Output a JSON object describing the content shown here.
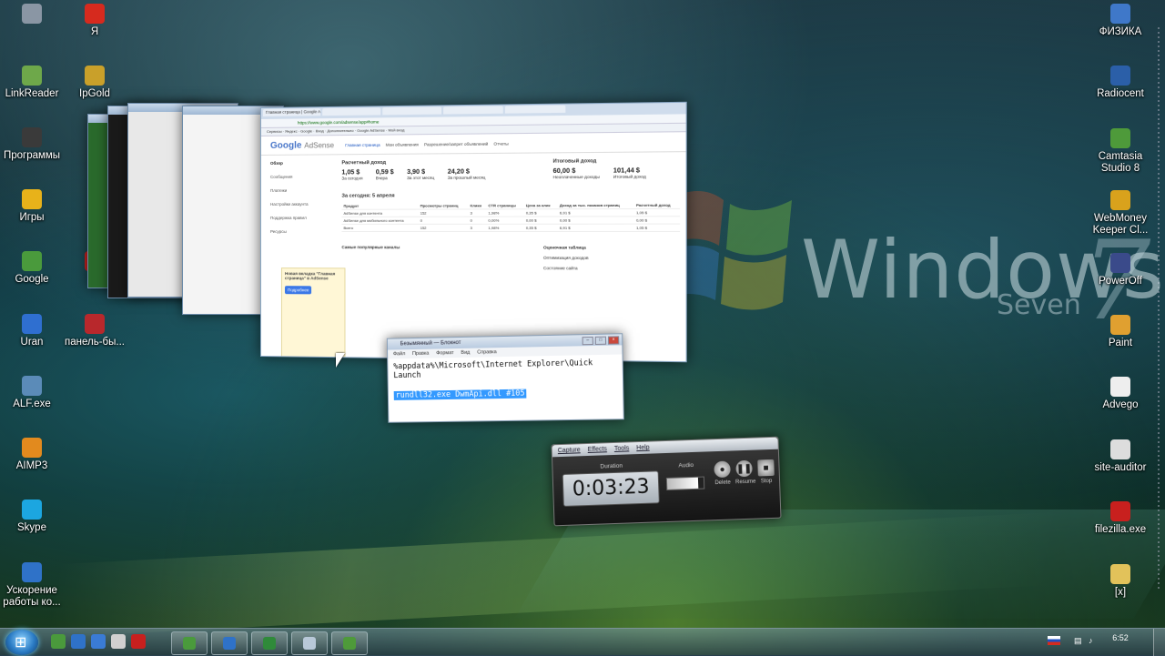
{
  "desktop": {
    "left_icons": [
      {
        "label": "",
        "icon": "small-app-icon",
        "color": "#8a96a4"
      },
      {
        "label": "Я",
        "icon": "yandex-icon",
        "color": "#d62a1e"
      },
      {
        "label": "LinkReader",
        "icon": "linkreader-icon",
        "color": "#6ea84a"
      },
      {
        "label": "IpGold",
        "icon": "ipgold-icon",
        "color": "#c9a02a"
      },
      {
        "label": "Программы",
        "icon": "programs-folder-icon",
        "color": "#3a3a3a"
      },
      {
        "label": "Игры",
        "icon": "games-star-icon",
        "color": "#e8b21a"
      },
      {
        "label": "Google",
        "icon": "chrome-icon",
        "color": "#4a9a3c"
      },
      {
        "label": "",
        "icon": "opera-icon",
        "color": "#c8201e"
      },
      {
        "label": "Uran",
        "icon": "uran-browser-icon",
        "color": "#2f6fd0"
      },
      {
        "label": "панель-бы...",
        "icon": "panel-icon",
        "color": "#b8282c"
      },
      {
        "label": "ALF.exe",
        "icon": "shield-icon",
        "color": "#5b8bb8"
      },
      {
        "label": "AIMP3",
        "icon": "aimp-icon",
        "color": "#e28a1e"
      },
      {
        "label": "Skype",
        "icon": "skype-icon",
        "color": "#1ca6e0"
      },
      {
        "label": "Ускорение работы ко...",
        "icon": "speedup-icon",
        "color": "#2f72c8"
      }
    ],
    "right_icons": [
      {
        "label": "ФИЗИКА",
        "icon": "shield-folder-icon",
        "color": "#3f78c9"
      },
      {
        "label": "Radiocent",
        "icon": "radiocent-icon",
        "color": "#2b5fa8"
      },
      {
        "label": "Camtasia Studio 8",
        "icon": "camtasia-icon",
        "color": "#4e9a3a"
      },
      {
        "label": "WebMoney Keeper Cl...",
        "icon": "webmoney-icon",
        "color": "#d9a21c"
      },
      {
        "label": "PowerOff",
        "icon": "poweroff-icon",
        "color": "#3a4a8a"
      },
      {
        "label": "Paint",
        "icon": "paint-icon",
        "color": "#e0a030"
      },
      {
        "label": "Advego",
        "icon": "advego-icon",
        "color": "#eeeeee"
      },
      {
        "label": "site-auditor",
        "icon": "site-auditor-icon",
        "color": "#dddddd"
      },
      {
        "label": "filezilla.exe",
        "icon": "filezilla-icon",
        "color": "#c8201e"
      },
      {
        "label": "[x]",
        "icon": "folder-icon",
        "color": "#e2c25a"
      }
    ],
    "wallpaper": {
      "brand": "Windows",
      "edition": "Seven",
      "number": "7"
    }
  },
  "adsense_window": {
    "tabs": [
      "Главная страница | Google AdSense",
      "",
      "",
      "",
      "",
      ""
    ],
    "address": "https://www.google.com/adsense/app#home",
    "bookmarks": "Сервисы · Яндекс · Google · Вход · Дополнительно · Google AdSense · Мой вход",
    "logo": "Google",
    "logo_product": "AdSense",
    "nav": [
      "Главная страница",
      "Мои объявления",
      "Разрешение/запрет объявлений",
      "Отчеты"
    ],
    "sidebar": [
      "Обзор",
      "Сообщения",
      "Платежи",
      "Настройки аккаунта",
      "Поддержка правил",
      "Ресурсы"
    ],
    "revenue_title": "Расчетный доход",
    "stats": [
      {
        "value": "1,05 $",
        "label": "За сегодня"
      },
      {
        "value": "0,59 $",
        "label": "Вчера"
      },
      {
        "value": "3,90 $",
        "label": "За этот месяц"
      },
      {
        "value": "24,20 $",
        "label": "За прошлый месяц"
      }
    ],
    "balance_title": "Итоговый доход",
    "balance": [
      {
        "value": "60,00 $",
        "label": "Неоплаченные доходы"
      },
      {
        "value": "101,44 $",
        "label": "Итоговый доход"
      }
    ],
    "table_title": "За сегодня: 5 апреля",
    "table_headers": [
      "Продукт",
      "Просмотры страниц",
      "Клики",
      "CTR страницы",
      "Цена за клик",
      "Доход за тыс. показов страниц",
      "Расчетный доход"
    ],
    "table_rows": [
      [
        "AdSense для контента",
        "152",
        "3",
        "1,98%",
        "0,35 $",
        "6,91 $",
        "1,05 $"
      ],
      [
        "AdSense для мобильного контента",
        "0",
        "0",
        "0,00%",
        "0,00 $",
        "0,00 $",
        "0,00 $"
      ],
      [
        "Всего",
        "152",
        "3",
        "1,98%",
        "0,35 $",
        "6,91 $",
        "1,05 $"
      ]
    ],
    "promo_title": "Новая вкладка \"Главная страница\" в AdSense",
    "promo_button": "Подробнее",
    "popular_channels": "Самые популярные каналы",
    "optimization": "Оценочная таблица",
    "opt_items": [
      "Оптимизация доходов",
      "Состояние сайта"
    ]
  },
  "notepad": {
    "title": "Безымянный — Блокнот",
    "menu": [
      "Файл",
      "Правка",
      "Формат",
      "Вид",
      "Справка"
    ],
    "line1": "%appdata%\\Microsoft\\Internet Explorer\\Quick Launch",
    "line2_selected": "rundll32.exe DwmApi.dll #105"
  },
  "recorder": {
    "menu": [
      "Capture",
      "Effects",
      "Tools",
      "Help"
    ],
    "duration_label": "Duration",
    "time": "0:03:23",
    "audio_label": "Audio",
    "audio_level": 0.85,
    "buttons": [
      "Delete",
      "Resume",
      "Stop"
    ]
  },
  "taskbar": {
    "quick_launch": [
      {
        "icon": "chrome-ql-icon",
        "color": "#4a9a3c"
      },
      {
        "icon": "ie-ql-icon",
        "color": "#2f72c8"
      },
      {
        "icon": "explorer-ql-icon",
        "color": "#3a7bd5"
      },
      {
        "icon": "media-ql-icon",
        "color": "#d0d0d0"
      },
      {
        "icon": "opera-ql-icon",
        "color": "#c8201e"
      }
    ],
    "running": [
      {
        "icon": "chrome-task-icon",
        "color": "#4a9a3c"
      },
      {
        "icon": "ie-task-icon",
        "color": "#2f72c8"
      },
      {
        "icon": "excel-task-icon",
        "color": "#2f8a3a"
      },
      {
        "icon": "notepad-task-icon",
        "color": "#b8c8d8"
      },
      {
        "icon": "camtasia-task-icon",
        "color": "#4e9a3a"
      }
    ],
    "clock": "6:52"
  }
}
